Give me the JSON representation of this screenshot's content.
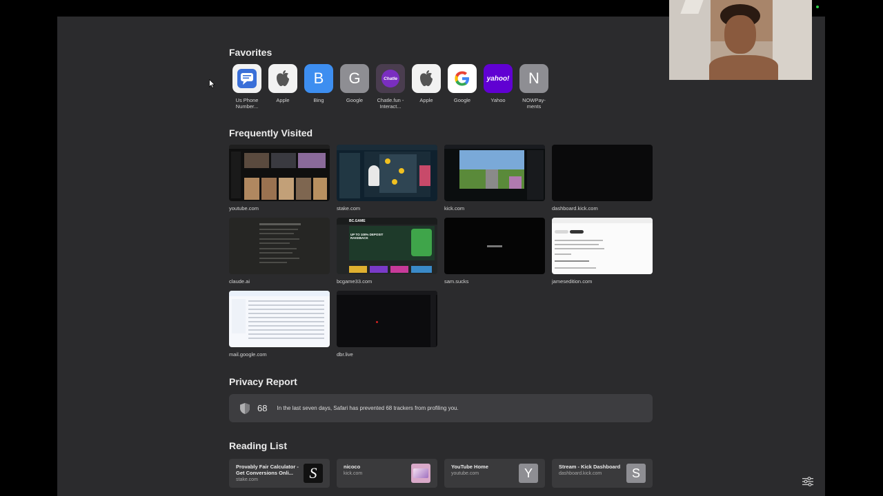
{
  "favorites": {
    "title": "Favorites",
    "items": [
      {
        "label": "Us Phone Number...",
        "glyph": "",
        "bg": "#f2f2f2",
        "icon": "chat-bubble-icon"
      },
      {
        "label": "Apple",
        "glyph": "",
        "bg": "#f2f2f2",
        "icon": "apple-icon"
      },
      {
        "label": "Bing",
        "glyph": "B",
        "bg": "#3d8ef0",
        "icon": "letter-b-icon"
      },
      {
        "label": "Google",
        "glyph": "G",
        "bg": "#8e8e93",
        "icon": "letter-g-icon"
      },
      {
        "label": "Chatle.fun - Interact...",
        "glyph": "Chatle",
        "bg": "#4a3d4f",
        "icon": "chatle-logo-icon"
      },
      {
        "label": "Apple",
        "glyph": "",
        "bg": "#f2f2f2",
        "icon": "apple-icon"
      },
      {
        "label": "Google",
        "glyph": "G",
        "bg": "#ffffff",
        "icon": "google-logo-icon"
      },
      {
        "label": "Yahoo",
        "glyph": "yahoo!",
        "bg": "#6001d2",
        "icon": "yahoo-logo-icon"
      },
      {
        "label": "NOWPay-ments",
        "glyph": "N",
        "bg": "#8e8e93",
        "icon": "letter-n-icon"
      }
    ]
  },
  "frequently_visited": {
    "title": "Frequently Visited",
    "items": [
      {
        "label": "youtube.com"
      },
      {
        "label": "stake.com"
      },
      {
        "label": "kick.com"
      },
      {
        "label": "dashboard.kick.com"
      },
      {
        "label": "claude.ai"
      },
      {
        "label": "bcgame33.com"
      },
      {
        "label": "sam.sucks"
      },
      {
        "label": "jamesedition.com"
      },
      {
        "label": "mail.google.com"
      },
      {
        "label": "dbr.live"
      }
    ]
  },
  "thumb_text": {
    "bcgame_logo": "BC.GAME",
    "bcgame_promo": "UP TO 100% DEPOSIT RAKEBACK"
  },
  "privacy": {
    "title": "Privacy Report",
    "count": "68",
    "text": "In the last seven days, Safari has prevented 68 trackers from profiling you."
  },
  "reading_list": {
    "title": "Reading List",
    "items": [
      {
        "title": "Provably Fair Calculator - Get Conversions Onli...",
        "domain": "stake.com",
        "glyph": "S",
        "bg": "#111111"
      },
      {
        "title": "nicoco",
        "domain": "kick.com",
        "glyph": "",
        "bg": "#d9a9c9"
      },
      {
        "title": "YouTube Home",
        "domain": "youtube.com",
        "glyph": "Y",
        "bg": "#8e8e93"
      },
      {
        "title": "Stream - Kick Dashboard",
        "domain": "dashboard.kick.com",
        "glyph": "S",
        "bg": "#8e8e93"
      }
    ]
  }
}
